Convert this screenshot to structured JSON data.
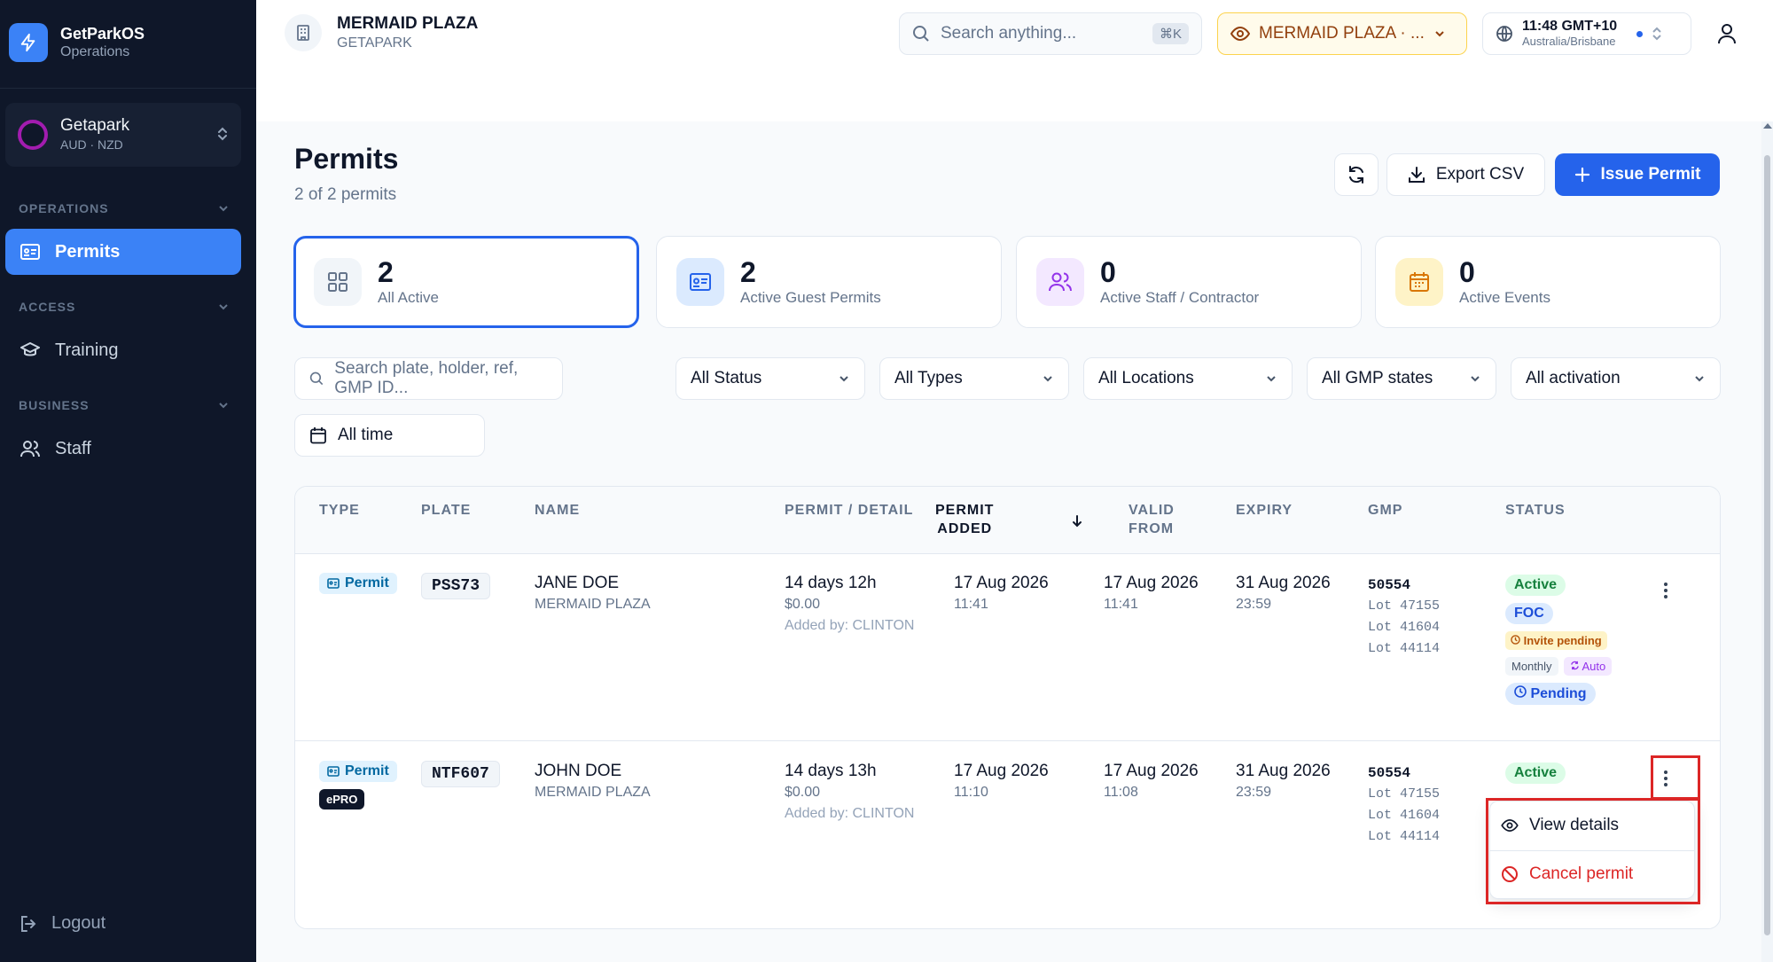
{
  "app": {
    "name": "GetParkOS",
    "subtitle": "Operations"
  },
  "org": {
    "name": "Getapark",
    "currencies": "AUD · NZD"
  },
  "sidebar": {
    "sections": [
      {
        "label": "OPERATIONS",
        "items": [
          {
            "label": "Permits",
            "icon": "id-card-icon",
            "active": true
          }
        ]
      },
      {
        "label": "ACCESS",
        "items": [
          {
            "label": "Training",
            "icon": "graduation-cap-icon",
            "active": false
          }
        ]
      },
      {
        "label": "BUSINESS",
        "items": [
          {
            "label": "Staff",
            "icon": "users-icon",
            "active": false
          }
        ]
      }
    ],
    "logout": "Logout"
  },
  "header": {
    "site_title": "MERMAID PLAZA",
    "site_subtitle": "GETAPARK",
    "search_placeholder": "Search anything...",
    "search_shortcut": "⌘K",
    "site_selector": "MERMAID PLAZA · ...",
    "time": "11:48 GMT+10",
    "timezone": "Australia/Brisbane"
  },
  "page": {
    "title": "Permits",
    "subtitle": "2 of 2 permits",
    "export_label": "Export CSV",
    "issue_label": "Issue Permit"
  },
  "stats": [
    {
      "value": "2",
      "label": "All Active",
      "icon": "grid-icon",
      "color": "#64748b",
      "bg": "#f1f5f9",
      "selected": true
    },
    {
      "value": "2",
      "label": "Active Guest Permits",
      "icon": "id-card-icon",
      "color": "#2563eb",
      "bg": "#dbeafe",
      "selected": false
    },
    {
      "value": "0",
      "label": "Active Staff / Contractor",
      "icon": "users-icon",
      "color": "#9333ea",
      "bg": "#f3e8ff",
      "selected": false
    },
    {
      "value": "0",
      "label": "Active Events",
      "icon": "calendar-icon",
      "color": "#d97706",
      "bg": "#fef3c7",
      "selected": false
    }
  ],
  "filters": {
    "search_placeholder": "Search plate, holder, ref, GMP ID...",
    "status": "All Status",
    "types": "All Types",
    "locations": "All Locations",
    "gmp_states": "All GMP states",
    "activation": "All activation",
    "time": "All time"
  },
  "table": {
    "columns": {
      "type": "TYPE",
      "plate": "PLATE",
      "name": "NAME",
      "detail": "PERMIT / DETAIL",
      "added_line1": "PERMIT",
      "added_line2": "ADDED",
      "valid_line1": "VALID",
      "valid_line2": "FROM",
      "expiry": "EXPIRY",
      "gmp": "GMP",
      "status": "STATUS"
    },
    "rows": [
      {
        "type": "Permit",
        "plate": "PSS73",
        "name": "JANE DOE",
        "location": "MERMAID PLAZA",
        "duration": "14 days 12h",
        "price": "$0.00",
        "added_by": "Added by: CLINTON",
        "added_date": "17 Aug 2026",
        "added_time": "11:41",
        "valid_date": "17 Aug 2026",
        "valid_time": "11:41",
        "expiry_date": "31 Aug 2026",
        "expiry_time": "23:59",
        "gmp_id": "50554",
        "lots": [
          "Lot 47155",
          "Lot 41604",
          "Lot 44114"
        ],
        "status": "Active",
        "rate": "FOC",
        "invite": "Invite pending",
        "billing": "Monthly",
        "renew": "Auto",
        "activation": "Pending"
      },
      {
        "type": "Permit",
        "tag": "ePRO",
        "plate": "NTF607",
        "name": "JOHN DOE",
        "location": "MERMAID PLAZA",
        "duration": "14 days 13h",
        "price": "$0.00",
        "added_by": "Added by: CLINTON",
        "added_date": "17 Aug 2026",
        "added_time": "11:10",
        "valid_date": "17 Aug 2026",
        "valid_time": "11:08",
        "expiry_date": "31 Aug 2026",
        "expiry_time": "23:59",
        "gmp_id": "50554",
        "lots": [
          "Lot 47155",
          "Lot 41604",
          "Lot 44114"
        ],
        "status": "Active"
      }
    ]
  },
  "row_menu": {
    "view": "View details",
    "cancel": "Cancel permit"
  },
  "colors": {
    "accent": "#3b82f6",
    "primary": "#2563eb",
    "sidebar": "#0f1729",
    "danger": "#dc2626"
  }
}
